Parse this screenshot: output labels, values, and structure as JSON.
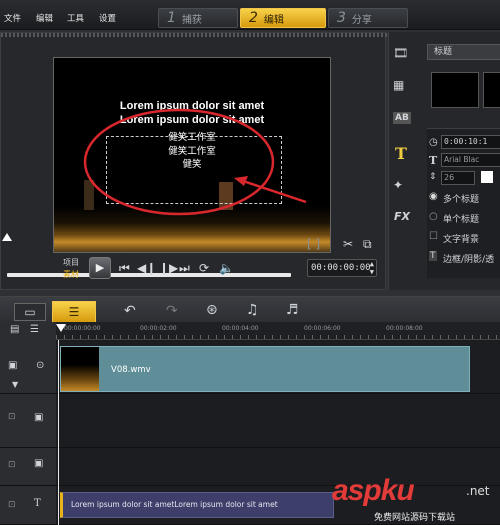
{
  "menu": {
    "file": "文件",
    "edit": "编辑",
    "tools": "工具",
    "settings": "设置"
  },
  "stages": [
    {
      "num": "1",
      "label": "捕获"
    },
    {
      "num": "2",
      "label": "编辑"
    },
    {
      "num": "3",
      "label": "分享"
    }
  ],
  "preview": {
    "line1": "Lorem ipsum dolor sit amet",
    "line2": "Lorem ipsum dolor sit amet",
    "line3": "健笑工作室",
    "line4": "健笑工作室",
    "line5": "健笑",
    "mode_project": "项目",
    "mode_clip": "素材",
    "timecode": "00:00:00:00"
  },
  "right": {
    "category": "标题",
    "duration": "0:00:10:1",
    "font": "Arial Blac",
    "size": "26",
    "opt_multi": "多个标题",
    "opt_single": "单个标题",
    "opt_bg": "文字背景",
    "opt_border": "边框/阴影/透"
  },
  "ruler": [
    "00:00:00:00",
    "00:00:02:00",
    "00:00:04:00",
    "00:00:06:00",
    "00:00:08:00"
  ],
  "tracks": {
    "video_clip": "V08.wmv",
    "title_clip": "Lorem ipsum dolor sit ametLorem ipsum dolor sit amet"
  },
  "watermark": {
    "brand": "aspku",
    "tld": ".net",
    "sub": "免费网站源码下载站"
  },
  "colors": {
    "accent": "#e8b21a",
    "video_clip": "#5f8e98",
    "title_clip": "#3d3f6a",
    "ellipse": "#d8282e"
  }
}
